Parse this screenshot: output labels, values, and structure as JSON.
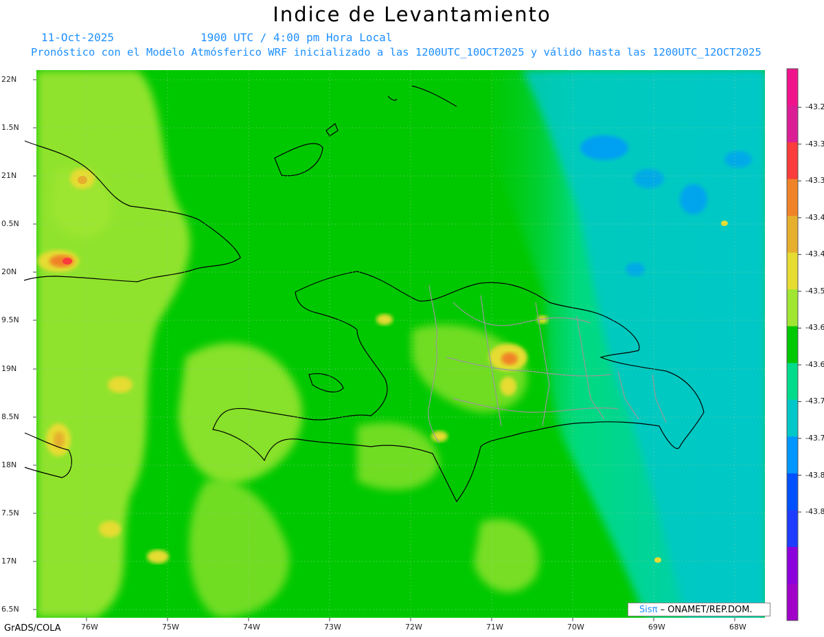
{
  "title": "Indice de Levantamiento",
  "date": "11-Oct-2025",
  "time": "1900 UTC / 4:00 pm Hora Local",
  "forecast": "Pronóstico con el Modelo Atmósferico WRF inicializado a las 1200UTC_10OCT2025 y válido hasta las  1200UTC_12OCT2025",
  "credit": "GrADS/COLA",
  "logo": {
    "mark": "Sisπ",
    "text": "– ONAMET/REP.DOM."
  },
  "axes": {
    "lat_labels": [
      "22N",
      "1.5N",
      "21N",
      "0.5N",
      "20N",
      "9.5N",
      "19N",
      "8.5N",
      "18N",
      "7.5N",
      "17N",
      "6.5N"
    ],
    "lon_labels": [
      "76W",
      "75W",
      "74W",
      "73W",
      "72W",
      "71W",
      "70W",
      "69W",
      "68W"
    ]
  },
  "colorbar": {
    "labels": [
      "-43.2",
      "-43.3",
      "-43.3",
      "-43.4",
      "-43.4",
      "-43.5",
      "-43.6",
      "-43.6",
      "-43.7",
      "-43.7",
      "-43.8",
      "-43.8"
    ],
    "colors": [
      "#f0148c",
      "#dc1e96",
      "#fa3c3c",
      "#f08228",
      "#e6af2d",
      "#e6dc32",
      "#a0e632",
      "#00c800",
      "#00dc8c",
      "#00c8c8",
      "#0096ff",
      "#0050ff",
      "#1e3cff",
      "#8c00dc",
      "#a000c8"
    ]
  }
}
